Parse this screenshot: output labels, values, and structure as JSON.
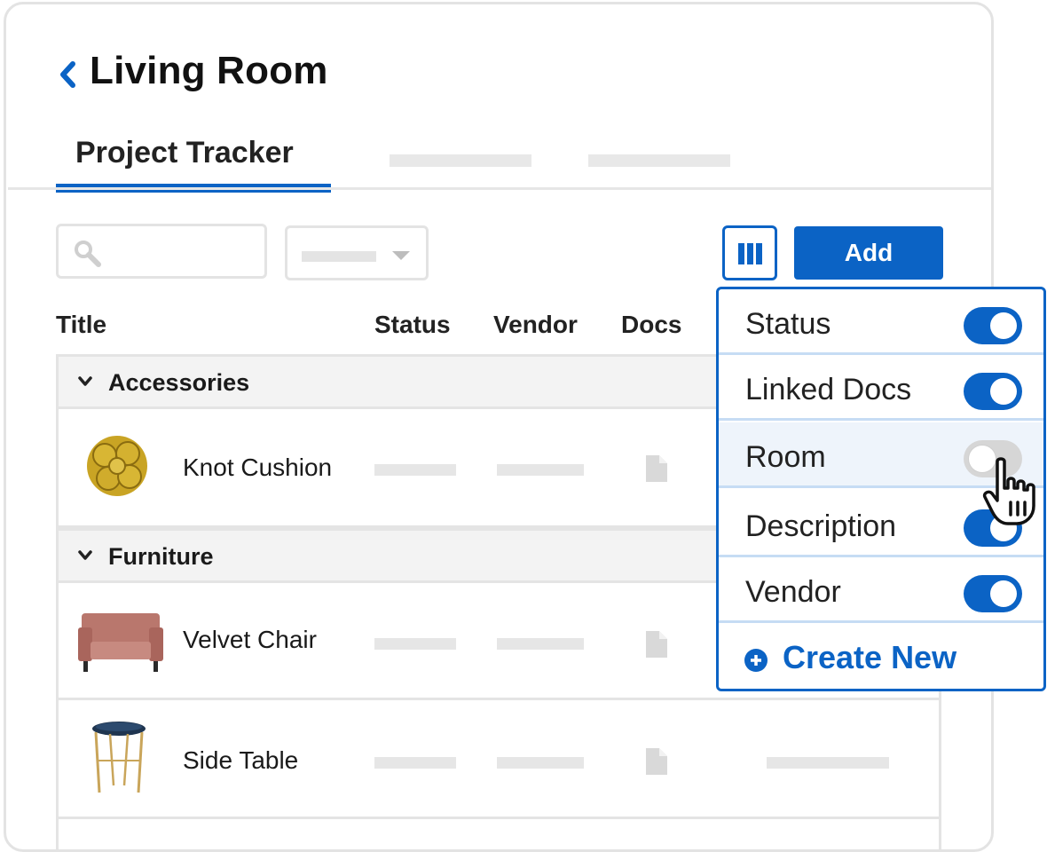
{
  "header": {
    "title": "Living Room"
  },
  "tabs": [
    {
      "label": "Project Tracker",
      "active": true
    },
    {
      "label": "",
      "active": false
    },
    {
      "label": "",
      "active": false
    }
  ],
  "toolbar": {
    "search_icon": "search-icon",
    "filter_select_value": "",
    "columns_icon": "columns-icon",
    "add_label": "Add"
  },
  "table": {
    "columns": [
      "Title",
      "Status",
      "Vendor",
      "Docs"
    ],
    "groups": [
      {
        "name": "Accessories",
        "rows": [
          {
            "title": "Knot Cushion"
          }
        ]
      },
      {
        "name": "Furniture",
        "rows": [
          {
            "title": "Velvet Chair"
          },
          {
            "title": "Side Table"
          }
        ]
      }
    ]
  },
  "column_menu": {
    "items": [
      {
        "label": "Status",
        "enabled": true
      },
      {
        "label": "Linked Docs",
        "enabled": true
      },
      {
        "label": "Room",
        "enabled": false
      },
      {
        "label": "Description",
        "enabled": true
      },
      {
        "label": "Vendor",
        "enabled": true
      }
    ],
    "create_label": "Create New"
  },
  "colors": {
    "accent": "#0b63c5",
    "border": "#e3e3e3",
    "menu_divider": "#c6dcf4",
    "group_bg": "#f3f3f3",
    "toggle_off": "#d6d6d6"
  }
}
